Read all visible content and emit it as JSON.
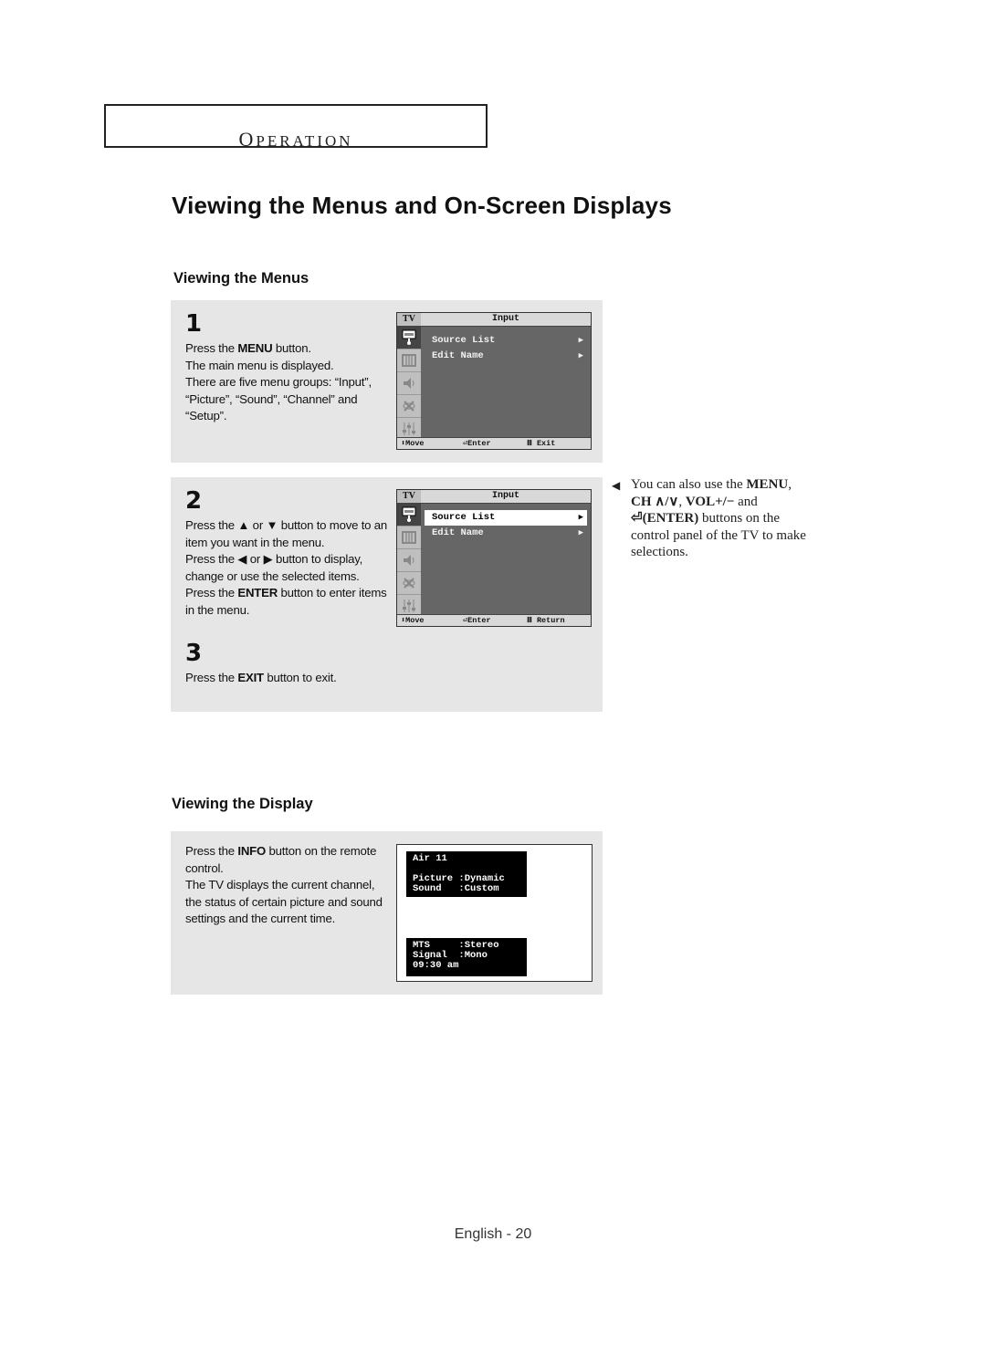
{
  "section": {
    "label_first": "O",
    "label_rest": "PERATION"
  },
  "page_title": "Viewing the Menus and On-Screen Displays",
  "menus_section": {
    "title": "Viewing the Menus",
    "steps": [
      {
        "number": "1",
        "lines": [
          {
            "pre": "Press the ",
            "bold": "MENU",
            "post": " button."
          },
          {
            "pre": "The main menu is displayed.",
            "bold": "",
            "post": ""
          },
          {
            "pre": "There are five menu groups: “Input”, “Picture”, “Sound”, “Channel” and “Setup”.",
            "bold": "",
            "post": ""
          }
        ]
      },
      {
        "number": "2",
        "lines": [
          {
            "pre": "Press the ▲ or ▼ button to move to an item you want in the menu.",
            "bold": "",
            "post": ""
          },
          {
            "pre": "Press the ◀ or ▶ button to display, change or use the selected items.",
            "bold": "",
            "post": ""
          },
          {
            "pre": "Press the ",
            "bold": "ENTER",
            "post": " button to enter items in the menu."
          }
        ]
      },
      {
        "number": "3",
        "lines": [
          {
            "pre": "Press the ",
            "bold": "EXIT",
            "post": " button to exit."
          }
        ]
      }
    ],
    "osd_screens": [
      {
        "tv_label": "TV",
        "title": "Input",
        "icons": [
          "input-icon",
          "picture-icon",
          "sound-icon",
          "channel-icon",
          "setup-icon"
        ],
        "items": [
          {
            "label": "Source List",
            "arrow": "▶",
            "selected": false
          },
          {
            "label": "Edit Name",
            "arrow": "▶",
            "selected": false
          }
        ],
        "footer": {
          "move": "⬍Move",
          "enter": "⏎Enter",
          "exit": "Ⅲ Exit"
        }
      },
      {
        "tv_label": "TV",
        "title": "Input",
        "icons": [
          "input-icon",
          "picture-icon",
          "sound-icon",
          "channel-icon",
          "setup-icon"
        ],
        "items": [
          {
            "label": "Source List",
            "arrow": "▶",
            "selected": true
          },
          {
            "label": "Edit Name",
            "arrow": "▶",
            "selected": false
          }
        ],
        "footer": {
          "move": "⬍Move",
          "enter": "⏎Enter",
          "exit": "Ⅲ Return"
        }
      }
    ],
    "note": {
      "pre": "You can also use the ",
      "b1": "MENU",
      "mid1": ", ",
      "b2": "CH ∧/∨",
      "mid2": ", ",
      "b3": "VOL+/−",
      "mid3": " and ",
      "b4": "⏎(ENTER)",
      "post": " buttons on the control panel of the TV to make selections."
    }
  },
  "display_section": {
    "title": "Viewing the Display",
    "lines": [
      {
        "pre": "Press the ",
        "bold": "INFO",
        "post": " button on the remote control."
      },
      {
        "pre": "The TV displays the current channel, the status of certain picture and sound settings and the current time.",
        "bold": "",
        "post": ""
      }
    ],
    "info_top": "Air 11\n\nPicture :Dynamic\nSound   :Custom",
    "info_bottom": "MTS     :Stereo\nSignal  :Mono\n09:30 am"
  },
  "footer": "English - 20"
}
